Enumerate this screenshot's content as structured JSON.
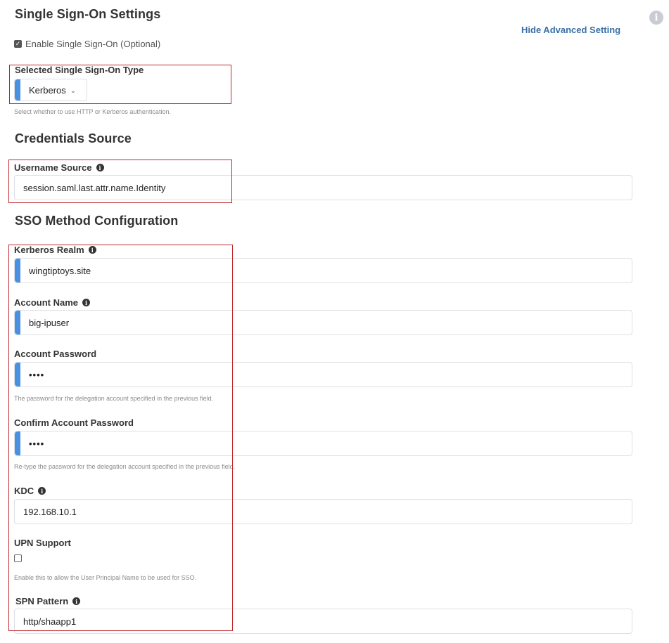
{
  "header": {
    "title": "Single Sign-On Settings",
    "advanced_link": "Hide Advanced Setting",
    "info_glyph": "i"
  },
  "sso": {
    "enable_label": "Enable Single Sign-On (Optional)",
    "enable_checked": true,
    "type_label": "Selected Single Sign-On Type",
    "type_value": "Kerberos",
    "type_help": "Select whether to use HTTP or Kerberos authentication."
  },
  "credentials": {
    "title": "Credentials Source",
    "username_label": "Username Source",
    "username_value": "session.saml.last.attr.name.Identity"
  },
  "method": {
    "title": "SSO Method Configuration",
    "realm_label": "Kerberos Realm",
    "realm_value": "wingtiptoys.site",
    "account_label": "Account Name",
    "account_value": "big-ipuser",
    "password_label": "Account Password",
    "password_value": "••••",
    "password_help": "The password for the delegation account specified in the previous field.",
    "confirm_label": "Confirm Account Password",
    "confirm_value": "••••",
    "confirm_help": "Re-type the password for the delegation account specified in the previous field.",
    "kdc_label": "KDC",
    "kdc_value": "192.168.10.1",
    "upn_label": "UPN Support",
    "upn_checked": false,
    "upn_help": "Enable this to allow the User Principal Name to be used for SSO.",
    "spn_label": "SPN Pattern",
    "spn_value": "http/shaapp1"
  },
  "icons": {
    "info": "info-icon",
    "checkbox_check": "check-icon",
    "dropdown": "chevron-down-icon"
  },
  "colors": {
    "required_bar": "#4a90e2",
    "link": "#3a6ea5",
    "highlight_box": "#c0272d"
  }
}
